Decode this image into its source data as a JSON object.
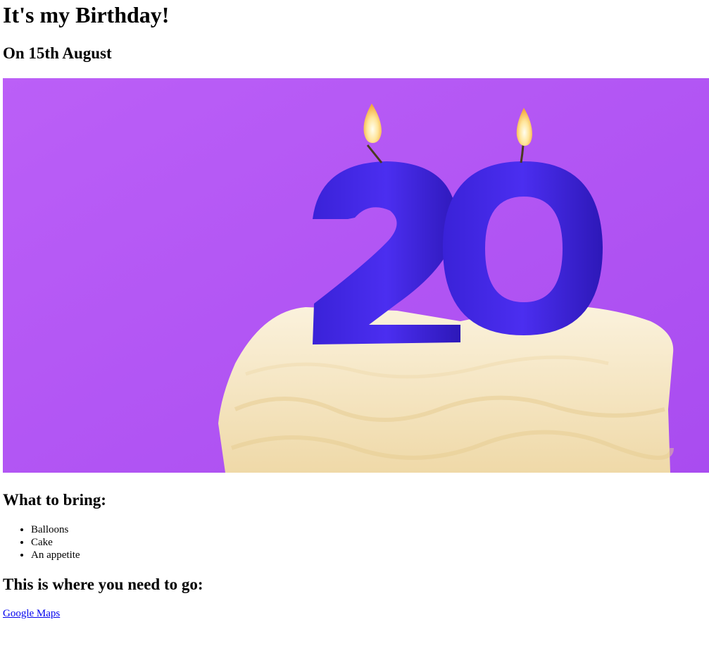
{
  "page": {
    "title": "It's my Birthday!",
    "date": "On 15th August"
  },
  "hero_image": {
    "alt": "Birthday cake with number 20 candles",
    "background_color": "#b45cf5",
    "candle_color": "#3a1ed6",
    "frosting_color": "#f6e7c6"
  },
  "bring": {
    "heading": "What to bring:",
    "items": [
      "Balloons",
      "Cake",
      "An appetite"
    ]
  },
  "directions": {
    "heading": "This is where you need to go:",
    "link_label": "Google Maps"
  }
}
